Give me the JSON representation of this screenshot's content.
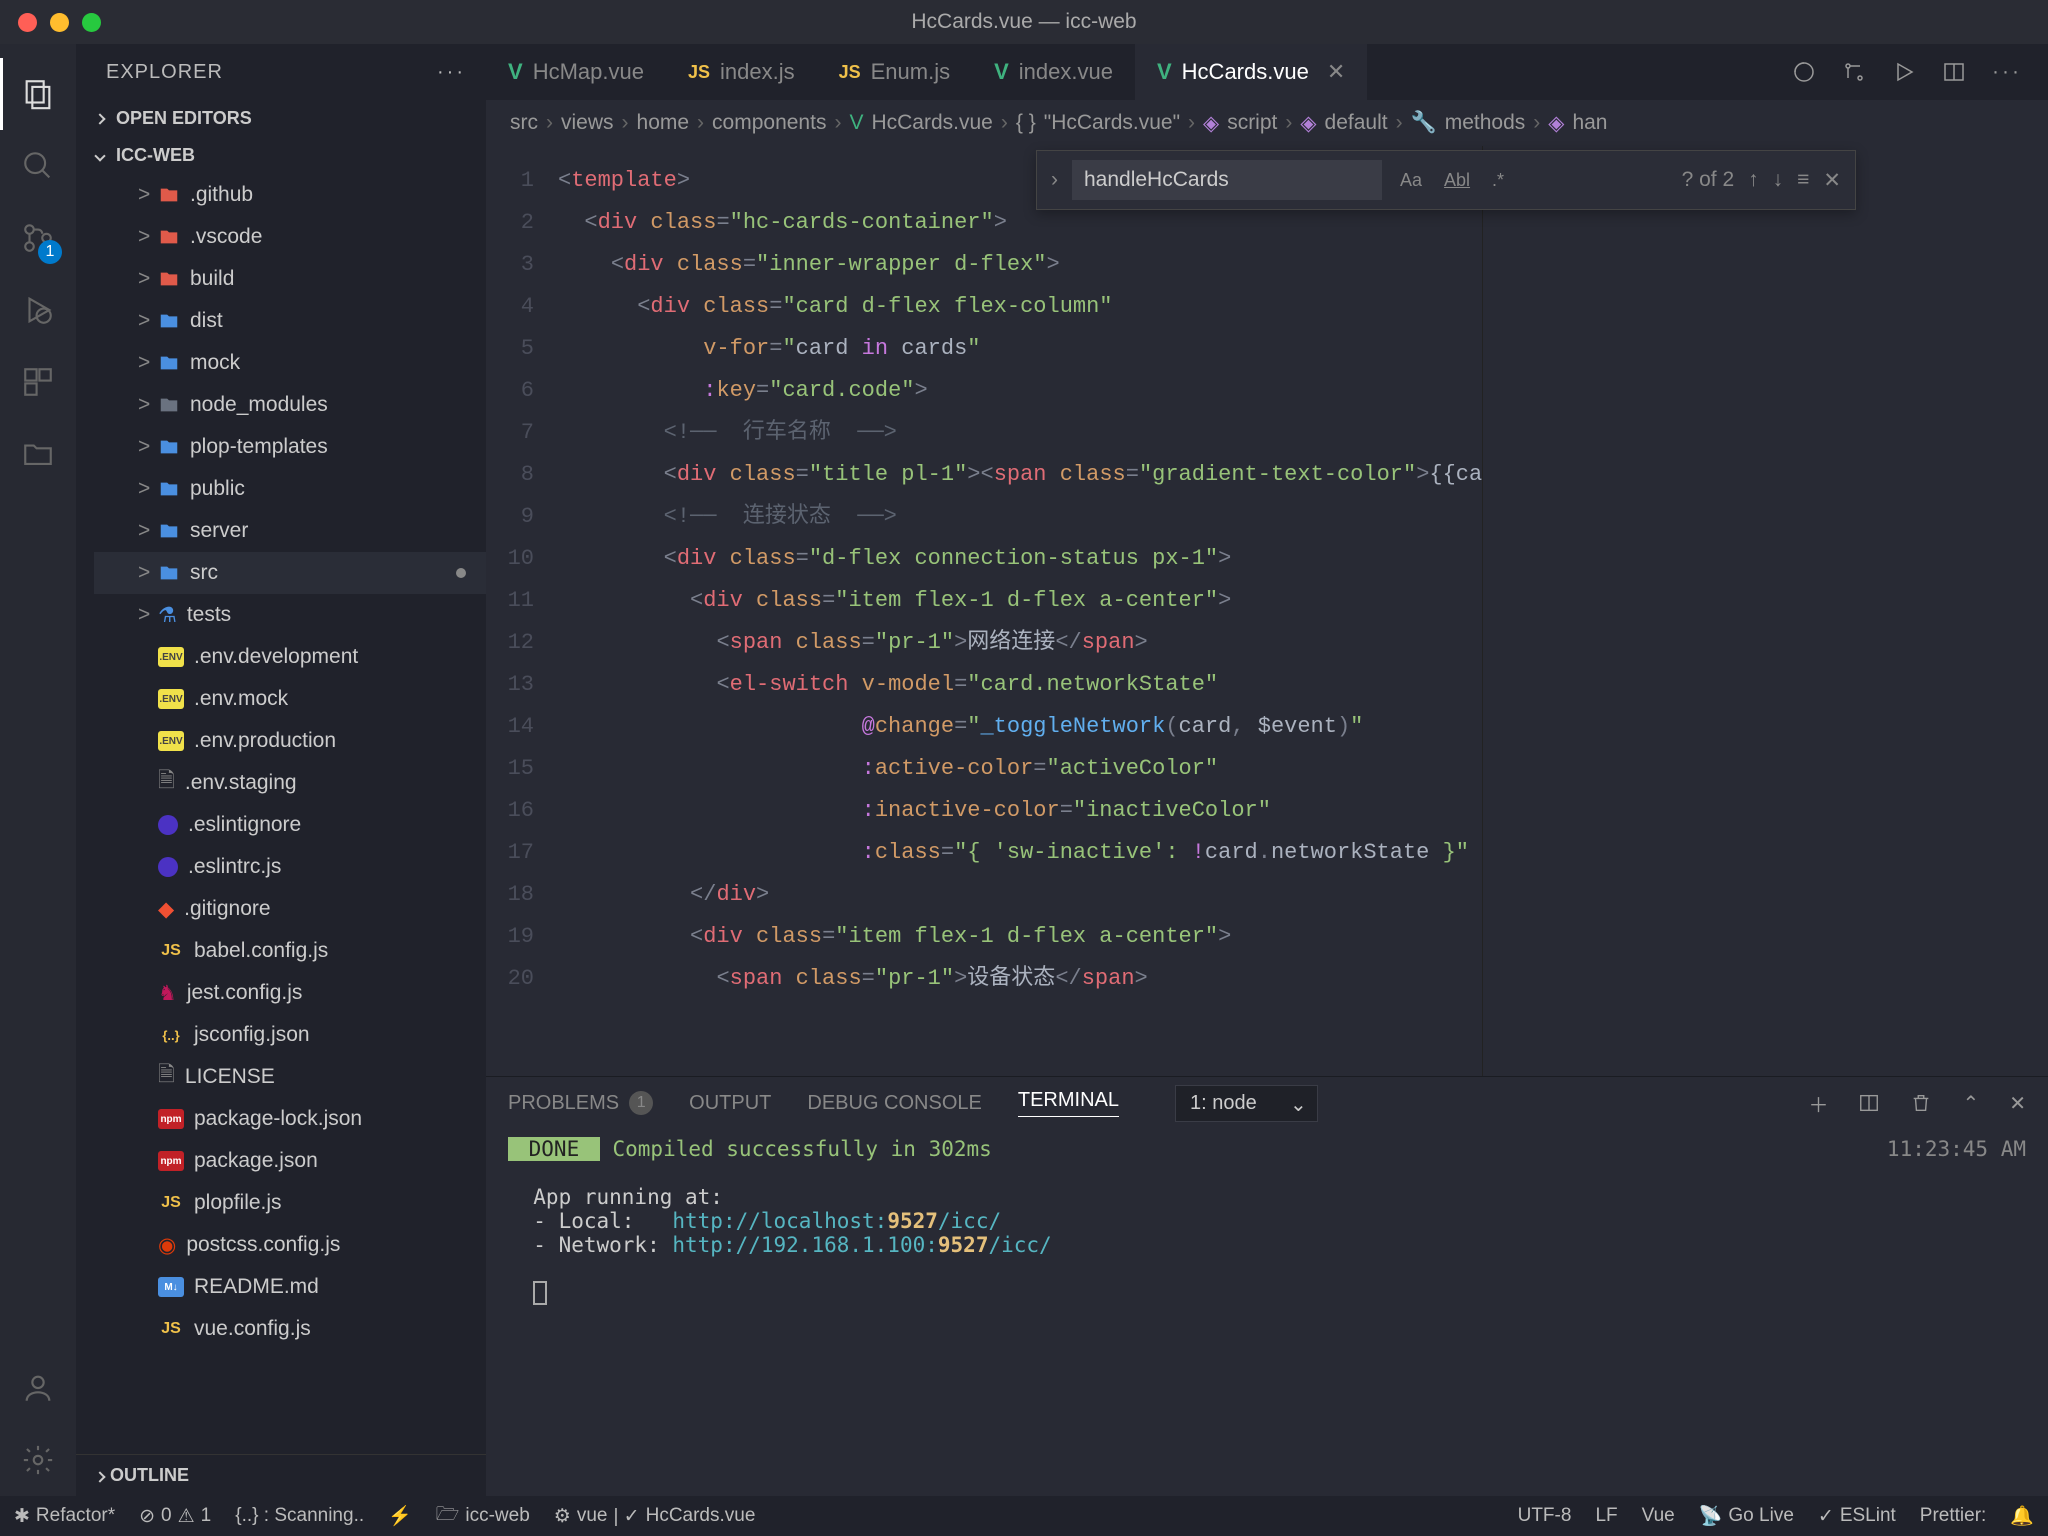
{
  "window": {
    "title": "HcCards.vue — icc-web"
  },
  "sidebar": {
    "title": "EXPLORER",
    "open_editors": "OPEN EDITORS",
    "project": "ICC-WEB",
    "outline": "OUTLINE",
    "tree": [
      {
        "name": ".github",
        "icon": "folder-red",
        "twisty": ">"
      },
      {
        "name": ".vscode",
        "icon": "folder-red",
        "twisty": ">"
      },
      {
        "name": "build",
        "icon": "folder-red",
        "twisty": ">"
      },
      {
        "name": "dist",
        "icon": "folder",
        "twisty": ">"
      },
      {
        "name": "mock",
        "icon": "folder",
        "twisty": ">"
      },
      {
        "name": "node_modules",
        "icon": "folder-grey",
        "twisty": ">"
      },
      {
        "name": "plop-templates",
        "icon": "folder",
        "twisty": ">"
      },
      {
        "name": "public",
        "icon": "folder",
        "twisty": ">"
      },
      {
        "name": "server",
        "icon": "folder",
        "twisty": ">"
      },
      {
        "name": "src",
        "icon": "folder",
        "twisty": ">",
        "dirty": true,
        "selected": true
      },
      {
        "name": "tests",
        "icon": "beaker",
        "twisty": ">"
      },
      {
        "name": ".env.development",
        "icon": "env"
      },
      {
        "name": ".env.mock",
        "icon": "env"
      },
      {
        "name": ".env.production",
        "icon": "env"
      },
      {
        "name": ".env.staging",
        "icon": "file"
      },
      {
        "name": ".eslintignore",
        "icon": "eslint"
      },
      {
        "name": ".eslintrc.js",
        "icon": "eslint"
      },
      {
        "name": ".gitignore",
        "icon": "git"
      },
      {
        "name": "babel.config.js",
        "icon": "js"
      },
      {
        "name": "jest.config.js",
        "icon": "jest"
      },
      {
        "name": "jsconfig.json",
        "icon": "json"
      },
      {
        "name": "LICENSE",
        "icon": "file"
      },
      {
        "name": "package-lock.json",
        "icon": "npm"
      },
      {
        "name": "package.json",
        "icon": "npm"
      },
      {
        "name": "plopfile.js",
        "icon": "js"
      },
      {
        "name": "postcss.config.js",
        "icon": "postcss"
      },
      {
        "name": "README.md",
        "icon": "md"
      },
      {
        "name": "vue.config.js",
        "icon": "js"
      }
    ]
  },
  "tabs": [
    {
      "name": "HcMap.vue",
      "icon": "vue"
    },
    {
      "name": "index.js",
      "icon": "js"
    },
    {
      "name": "Enum.js",
      "icon": "js"
    },
    {
      "name": "index.vue",
      "icon": "vue"
    },
    {
      "name": "HcCards.vue",
      "icon": "vue",
      "active": true,
      "close": true
    }
  ],
  "breadcrumb": [
    "src",
    "views",
    "home",
    "components",
    "HcCards.vue",
    "\"HcCards.vue\"",
    "script",
    "default",
    "methods",
    "han"
  ],
  "find": {
    "query": "handleHcCards",
    "count": "? of 2"
  },
  "code_lines": [
    "1",
    "2",
    "3",
    "4",
    "5",
    "6",
    "7",
    "8",
    "9",
    "10",
    "11",
    "12",
    "13",
    "14",
    "15",
    "16",
    "17",
    "18",
    "19",
    "20"
  ],
  "code": {
    "l1": "<template>",
    "l2": "  <div class=\"hc-cards-container\">",
    "l3": "    <div class=\"inner-wrapper d-flex\">",
    "l4": "      <div class=\"card d-flex flex-column\"",
    "l5": "           v-for=\"card in cards\"",
    "l6": "           :key=\"card.code\">",
    "l7_cmt": "行车名称",
    "l8a": "        <div class=\"title pl-1\"><span class=\"gradient-text-color\">{{ca",
    "l9_cmt": "连接状态",
    "l10": "        <div class=\"d-flex connection-status px-1\">",
    "l11": "          <div class=\"item flex-1 d-flex a-center\">",
    "l12a": "            <span class=\"pr-1\">",
    "l12b": "网络连接",
    "l12c": "</span>",
    "l13": "            <el-switch v-model=\"card.networkState\"",
    "l14": "                       @change=\"_toggleNetwork(card, $event)\"",
    "l15": "                       :active-color=\"activeColor\"",
    "l16": "                       :inactive-color=\"inactiveColor\"",
    "l17": "                       :class=\"{ 'sw-inactive': !card.networkState }\"",
    "l18": "          </div>",
    "l19": "          <div class=\"item flex-1 d-flex a-center\">",
    "l20a": "            <span class=\"pr-1\">",
    "l20b": "设备状态",
    "l20c": "</span>"
  },
  "panel": {
    "tabs": {
      "problems": "PROBLEMS",
      "problems_badge": "1",
      "output": "OUTPUT",
      "debug": "DEBUG CONSOLE",
      "terminal": "TERMINAL"
    },
    "task": "1: node",
    "time": "11:23:45 AM",
    "done": " DONE ",
    "done_msg": " Compiled successfully in 302ms",
    "running": "  App running at:",
    "local_lbl": "  - Local:   ",
    "local_url": "http://localhost:",
    "local_port": "9527",
    "local_path": "/icc/",
    "net_lbl": "  - Network: ",
    "net_url": "http://192.168.1.100:",
    "net_port": "9527",
    "net_path": "/icc/"
  },
  "status": {
    "refactor": "Refactor*",
    "err": "0",
    "warn": "1",
    "scanning": "{..} : Scanning..",
    "ws": "icc-web",
    "vue": "vue",
    "branch": "HcCards.vue",
    "encoding": "UTF-8",
    "eol": "LF",
    "lang": "Vue",
    "golive": "Go Live",
    "eslint": "ESLint",
    "prettier": "Prettier: "
  }
}
